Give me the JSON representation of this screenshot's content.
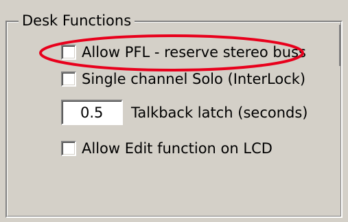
{
  "group": {
    "title": "Desk Functions"
  },
  "options": {
    "allow_pfl": {
      "label": "Allow PFL - reserve stereo buss",
      "checked": false
    },
    "single_channel_solo": {
      "label": "Single channel Solo (InterLock)",
      "checked": false
    },
    "talkback": {
      "value": "0.5",
      "label": "Talkback latch (seconds)"
    },
    "allow_edit_lcd": {
      "label": "Allow Edit function on LCD",
      "checked": false
    }
  },
  "annotation": {
    "color": "#e8001c"
  }
}
